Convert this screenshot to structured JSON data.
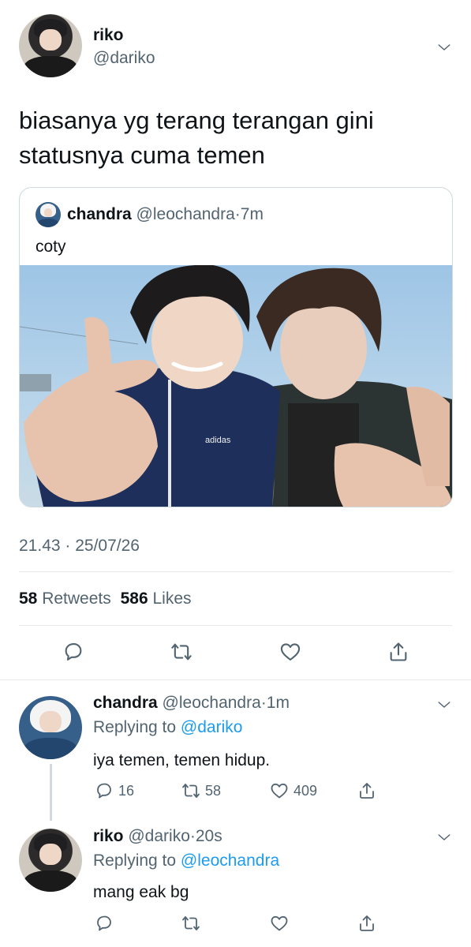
{
  "main_tweet": {
    "author_name": "riko",
    "author_handle": "@dariko",
    "text_line1": "biasanya yg terang terangan gini",
    "text_line2": "statusnya cuma temen",
    "timestamp": "21.43 · 25/07/26",
    "retweets_count": "58",
    "retweets_label": "Retweets",
    "likes_count": "586",
    "likes_label": "Likes"
  },
  "quoted_tweet": {
    "author_name": "chandra",
    "author_handle": "@leochandra",
    "time": "7m",
    "text": "coty",
    "photo_text": "adidas"
  },
  "replies": [
    {
      "author_name": "chandra",
      "author_handle": "@leochandra",
      "time": "1m",
      "replying_prefix": "Replying to",
      "replying_to": "@dariko",
      "text": "iya temen, temen hidup.",
      "reply_count": "16",
      "retweet_count": "58",
      "like_count": "409"
    },
    {
      "author_name": "riko",
      "author_handle": "@dariko",
      "time": "20s",
      "replying_prefix": "Replying to",
      "replying_to": "@leochandra",
      "text": "mang eak bg"
    }
  ],
  "colors": {
    "link_blue": "#1d9bf0",
    "muted_gray": "#536471",
    "text_dark": "#0f1419"
  },
  "icons": [
    "chevron-down-icon",
    "reply-icon",
    "retweet-icon",
    "like-icon",
    "share-icon"
  ]
}
